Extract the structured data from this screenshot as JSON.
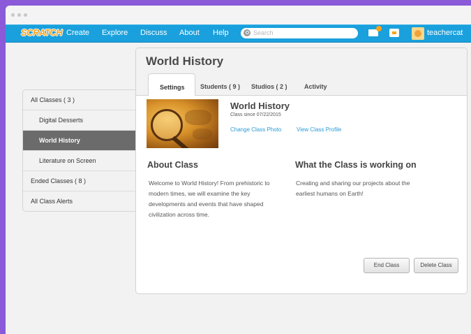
{
  "nav": {
    "logo": "SCRATCH",
    "links": [
      "Create",
      "Explore",
      "Discuss",
      "About",
      "Help"
    ],
    "search_placeholder": "Search",
    "username": "teachercat"
  },
  "sidebar": {
    "items": [
      {
        "label": "All Classes ( 3 )"
      },
      {
        "label": "Digital Desserts"
      },
      {
        "label": "World History"
      },
      {
        "label": "Literature on Screen"
      },
      {
        "label": "Ended Classes ( 8 )"
      },
      {
        "label": "All Class Alerts"
      }
    ]
  },
  "panel": {
    "title": "World History",
    "tabs": [
      "Settings",
      "Students ( 9 )",
      "Studios ( 2 )",
      "Activity"
    ],
    "class_name": "World History",
    "class_since": "Class since 07/22/2015",
    "change_photo": "Change Class Photo",
    "view_profile": "View Class Profile",
    "about_heading": "About Class",
    "about_lines": [
      "Welcome to World History! From prehistoric to",
      "modern times, we will examine the key",
      "developments and events that have shaped",
      "civilization across time."
    ],
    "working_heading": "What the Class is working on",
    "working_lines": [
      "Creating and sharing our projects about the",
      "earliest humans on Earth!"
    ],
    "end_button": "End Class",
    "delete_button": "Delete Class"
  },
  "colors": {
    "background": "#8a5ad8",
    "navbar": "#1aa0dc",
    "link": "#2b9ad4",
    "active_sidebar": "#6b6b6b"
  }
}
